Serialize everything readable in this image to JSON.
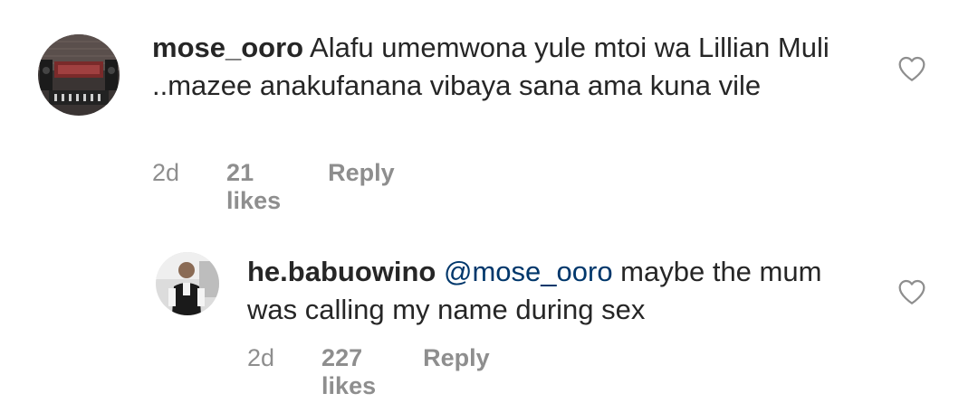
{
  "comments": [
    {
      "username": "mose_ooro",
      "text": " Alafu umemwona yule mtoi wa Lillian Muli ..mazee anakufanana vibaya sana ama kuna vile",
      "time": "2d",
      "likes": "21 likes",
      "reply_label": "Reply",
      "like_icon": "heart-outline-icon",
      "avatar": "profile-photo"
    },
    {
      "username": "he.babuowino",
      "mention": "@mose_ooro",
      "text": " maybe the mum was calling my name during sex",
      "time": "2d",
      "likes": "227 likes",
      "reply_label": "Reply",
      "like_icon": "heart-outline-icon",
      "avatar": "profile-photo"
    }
  ],
  "colors": {
    "text": "#262626",
    "secondary": "#8e8e8e",
    "mention": "#00376b",
    "background": "#ffffff"
  }
}
